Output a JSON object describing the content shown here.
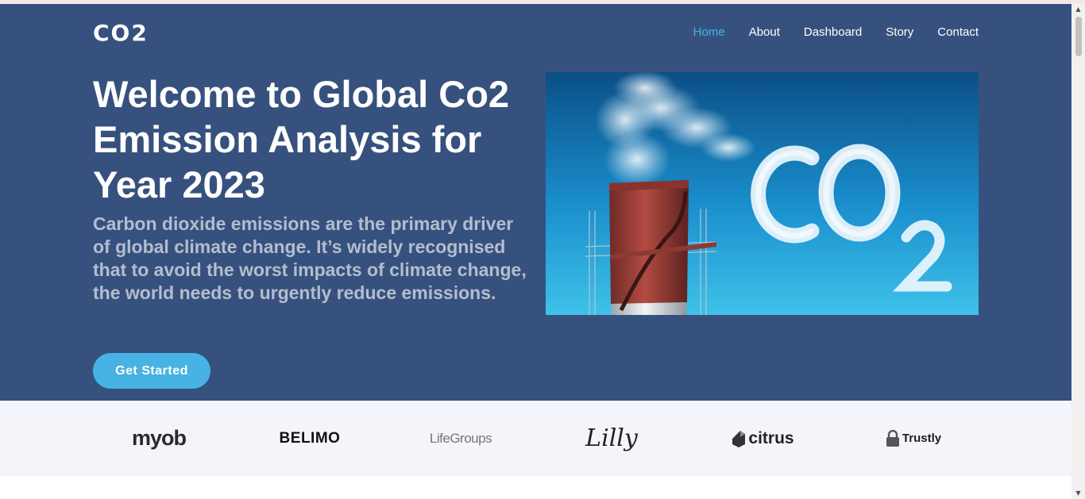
{
  "header": {
    "logo": "CO2",
    "nav": [
      "Home",
      "About",
      "Dashboard",
      "Story",
      "Contact"
    ],
    "active_nav": "Home"
  },
  "hero": {
    "title": "Welcome to Global Co2 Emission Analysis for Year 2023",
    "subtitle": "Carbon dioxide emissions are the primary driver of global climate change. It’s widely recognised that to avoid the worst impacts of climate change, the world needs to urgently reduce emissions.",
    "cta_label": "Get Started",
    "image_text": "CO2"
  },
  "clients": {
    "logos": [
      "myob",
      "BELIMO",
      "LifeGroups",
      "Lilly",
      "citrus",
      "Trustly"
    ]
  },
  "colors": {
    "hero_bg": "#37517e",
    "accent": "#47b2e4",
    "clients_bg": "#f3f5fa"
  }
}
